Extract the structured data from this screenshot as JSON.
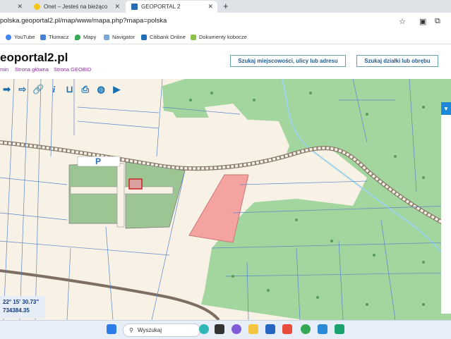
{
  "browser": {
    "tabs": [
      {
        "label": "Onet – Jesteś na bieżąco",
        "active": false,
        "favicon_color": "#f5c518"
      },
      {
        "label": "GEOPORTAL 2",
        "active": true,
        "favicon_color": "#2a6db5"
      }
    ],
    "url": "polska.geoportal2.pl/map/www/mapa.php?mapa=polska",
    "bookmarks": [
      {
        "label": "YouTube",
        "icon": "google-icon"
      },
      {
        "label": "Tłumacz",
        "icon": "translate-icon"
      },
      {
        "label": "Mapy",
        "icon": "maps-icon"
      },
      {
        "label": "Navigator",
        "icon": "navigator-icon"
      },
      {
        "label": "Citibank Online",
        "icon": "citibank-icon"
      },
      {
        "label": "Dokumenty kobocze",
        "icon": "docs-icon"
      }
    ]
  },
  "header": {
    "site_title": "eoportal2.pl",
    "links": [
      "min",
      "Strona główna",
      "Strona GEOBID"
    ],
    "search_place_button": "Szukaj miejscowości, ulicy lub adresu",
    "search_plot_button": "Szukaj działki lub obrębu"
  },
  "map": {
    "parking_label": "P",
    "coords": {
      "lon": "22° 15' 30.73\"",
      "y": "734384.35"
    },
    "colors": {
      "forest": "#9dd29a",
      "fields": "#f7f1e6",
      "plot": "#f4a6a3",
      "park": "#9dc593"
    }
  },
  "taskbar": {
    "search_placeholder": "Wyszukaj"
  }
}
